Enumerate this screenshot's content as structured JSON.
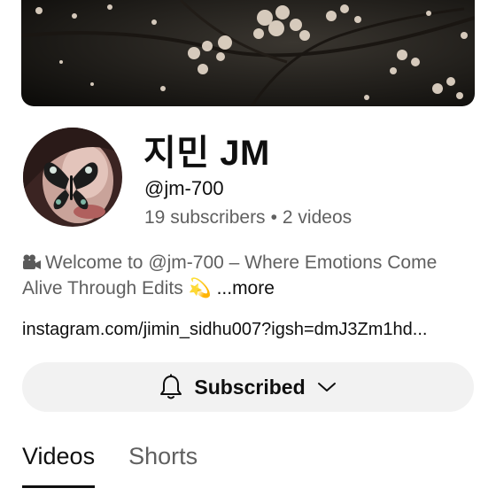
{
  "channel": {
    "name": "지민 JM",
    "handle": "@jm-700",
    "subscribers": "19 subscribers",
    "separator": "•",
    "videos": "2 videos"
  },
  "description": {
    "emoji_icon": "movie-camera-icon",
    "text": "Welcome to @jm-700 – Where Emotions Come Alive Through Edits",
    "trailing_emoji": "💫",
    "more_label": "...more"
  },
  "link": {
    "text": "instagram.com/jimin_sidhu007?igsh=dmJ3Zm1hd..."
  },
  "subscribe_button": {
    "label": "Subscribed",
    "bell_icon": "bell-icon",
    "chevron_icon": "chevron-down-icon"
  },
  "tabs": [
    {
      "label": "Videos",
      "active": true
    },
    {
      "label": "Shorts",
      "active": false
    }
  ],
  "colors": {
    "primary_text": "#0f0f0f",
    "secondary_text": "#606060",
    "button_bg": "#f2f2f2"
  }
}
